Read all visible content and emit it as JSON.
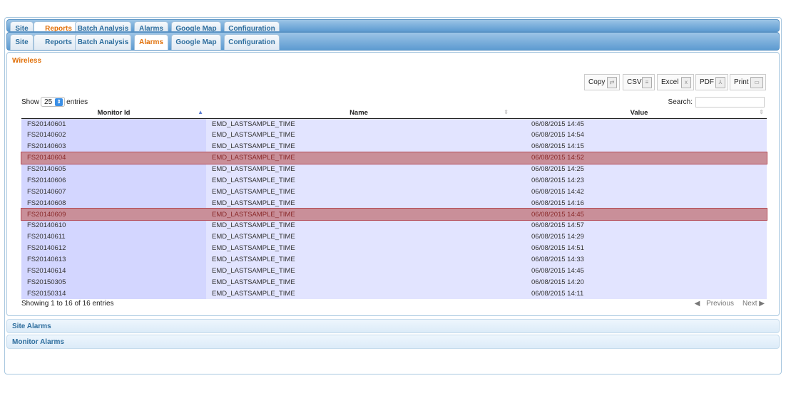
{
  "tabs": [
    {
      "label": "Site"
    },
    {
      "label": "Reports"
    },
    {
      "label": "Batch Analysis"
    },
    {
      "label": "Alarms"
    },
    {
      "label": "Google Map"
    },
    {
      "label": "Configuration"
    }
  ],
  "ghost_active": "Reports",
  "active_tab": "Alarms",
  "panel": {
    "title": "Wireless"
  },
  "toolbar": {
    "copy": "Copy",
    "csv": "CSV",
    "excel": "Excel",
    "pdf": "PDF",
    "print": "Print"
  },
  "length": {
    "show": "Show",
    "value": "25",
    "entries": "entries"
  },
  "search": {
    "label": "Search:",
    "value": ""
  },
  "columns": [
    "Monitor Id",
    "Name",
    "Value"
  ],
  "rows": [
    [
      "FS20140601",
      "EMD_LASTSAMPLE_TIME",
      "06/08/2015 14:45",
      false
    ],
    [
      "FS20140602",
      "EMD_LASTSAMPLE_TIME",
      "06/08/2015 14:54",
      false
    ],
    [
      "FS20140603",
      "EMD_LASTSAMPLE_TIME",
      "06/08/2015 14:15",
      false
    ],
    [
      "FS20140604",
      "EMD_LASTSAMPLE_TIME",
      "06/08/2015 14:52",
      true
    ],
    [
      "FS20140605",
      "EMD_LASTSAMPLE_TIME",
      "06/08/2015 14:25",
      false
    ],
    [
      "FS20140606",
      "EMD_LASTSAMPLE_TIME",
      "06/08/2015 14:23",
      false
    ],
    [
      "FS20140607",
      "EMD_LASTSAMPLE_TIME",
      "06/08/2015 14:42",
      false
    ],
    [
      "FS20140608",
      "EMD_LASTSAMPLE_TIME",
      "06/08/2015 14:16",
      false
    ],
    [
      "FS20140609",
      "EMD_LASTSAMPLE_TIME",
      "06/08/2015 14:45",
      true
    ],
    [
      "FS20140610",
      "EMD_LASTSAMPLE_TIME",
      "06/08/2015 14:57",
      false
    ],
    [
      "FS20140611",
      "EMD_LASTSAMPLE_TIME",
      "06/08/2015 14:29",
      false
    ],
    [
      "FS20140612",
      "EMD_LASTSAMPLE_TIME",
      "06/08/2015 14:51",
      false
    ],
    [
      "FS20140613",
      "EMD_LASTSAMPLE_TIME",
      "06/08/2015 14:33",
      false
    ],
    [
      "FS20140614",
      "EMD_LASTSAMPLE_TIME",
      "06/08/2015 14:45",
      false
    ],
    [
      "FS20150305",
      "EMD_LASTSAMPLE_TIME",
      "06/08/2015 14:20",
      false
    ],
    [
      "FS20150314",
      "EMD_LASTSAMPLE_TIME",
      "06/08/2015 14:11",
      false
    ]
  ],
  "info": "Showing 1 to 16 of 16 entries",
  "pager": {
    "previous": "Previous",
    "next": "Next"
  },
  "sections": [
    {
      "label": "Site Alarms"
    },
    {
      "label": "Monitor Alarms"
    }
  ],
  "colors": {
    "accent": "#e17009",
    "link": "#2e6e9e",
    "row": "#e2e4ff",
    "highlight": "#c98f99"
  }
}
